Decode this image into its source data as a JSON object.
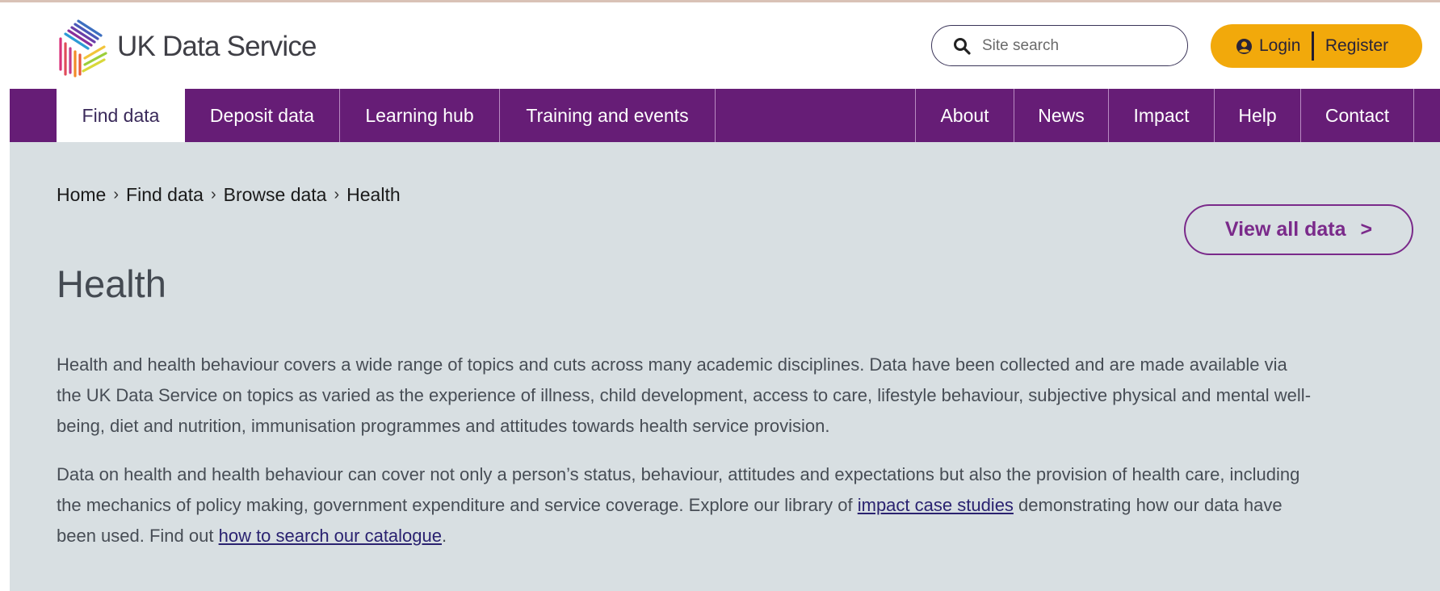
{
  "header": {
    "logo_text": "UK Data Service",
    "search": {
      "placeholder": "Site search"
    },
    "auth": {
      "login_label": "Login",
      "register_label": "Register"
    }
  },
  "nav": {
    "items": [
      {
        "label": "Find data",
        "active": true
      },
      {
        "label": "Deposit data"
      },
      {
        "label": "Learning hub"
      },
      {
        "label": "Training and events"
      },
      {
        "label": "About"
      },
      {
        "label": "News"
      },
      {
        "label": "Impact"
      },
      {
        "label": "Help"
      },
      {
        "label": "Contact"
      }
    ]
  },
  "breadcrumb": {
    "items": [
      "Home",
      "Find data",
      "Browse data",
      "Health"
    ],
    "separator": "›"
  },
  "main": {
    "view_all_label": "View all data",
    "view_all_arrow": ">",
    "title": "Health",
    "para1": "Health and health behaviour covers a wide range of topics and cuts across many academic disciplines. Data have been collected and are made available via the UK Data Service on topics as varied as the experience of illness, child development, access to care, lifestyle behaviour, subjective physical and mental well-being, diet and nutrition, immunisation programmes and attitudes towards health service provision.",
    "para2_part1": "Data on health and health behaviour can cover not only a person’s status, behaviour, attitudes and expectations but also the provision of health care, including the mechanics of policy making, government expenditure and service coverage. Explore our library of ",
    "para2_link1": "impact case studies",
    "para2_part2": " demonstrating how our data have been used. Find out ",
    "para2_link2": "how to search our catalogue",
    "para2_part3": "."
  },
  "colors": {
    "nav_bg": "#661d76",
    "accent_purple": "#7a2a8a",
    "auth_bg": "#f2a90b",
    "main_bg": "#d8dfe2",
    "link": "#2a2270"
  },
  "icons": [
    "logo-mark",
    "search-icon",
    "user-icon"
  ]
}
